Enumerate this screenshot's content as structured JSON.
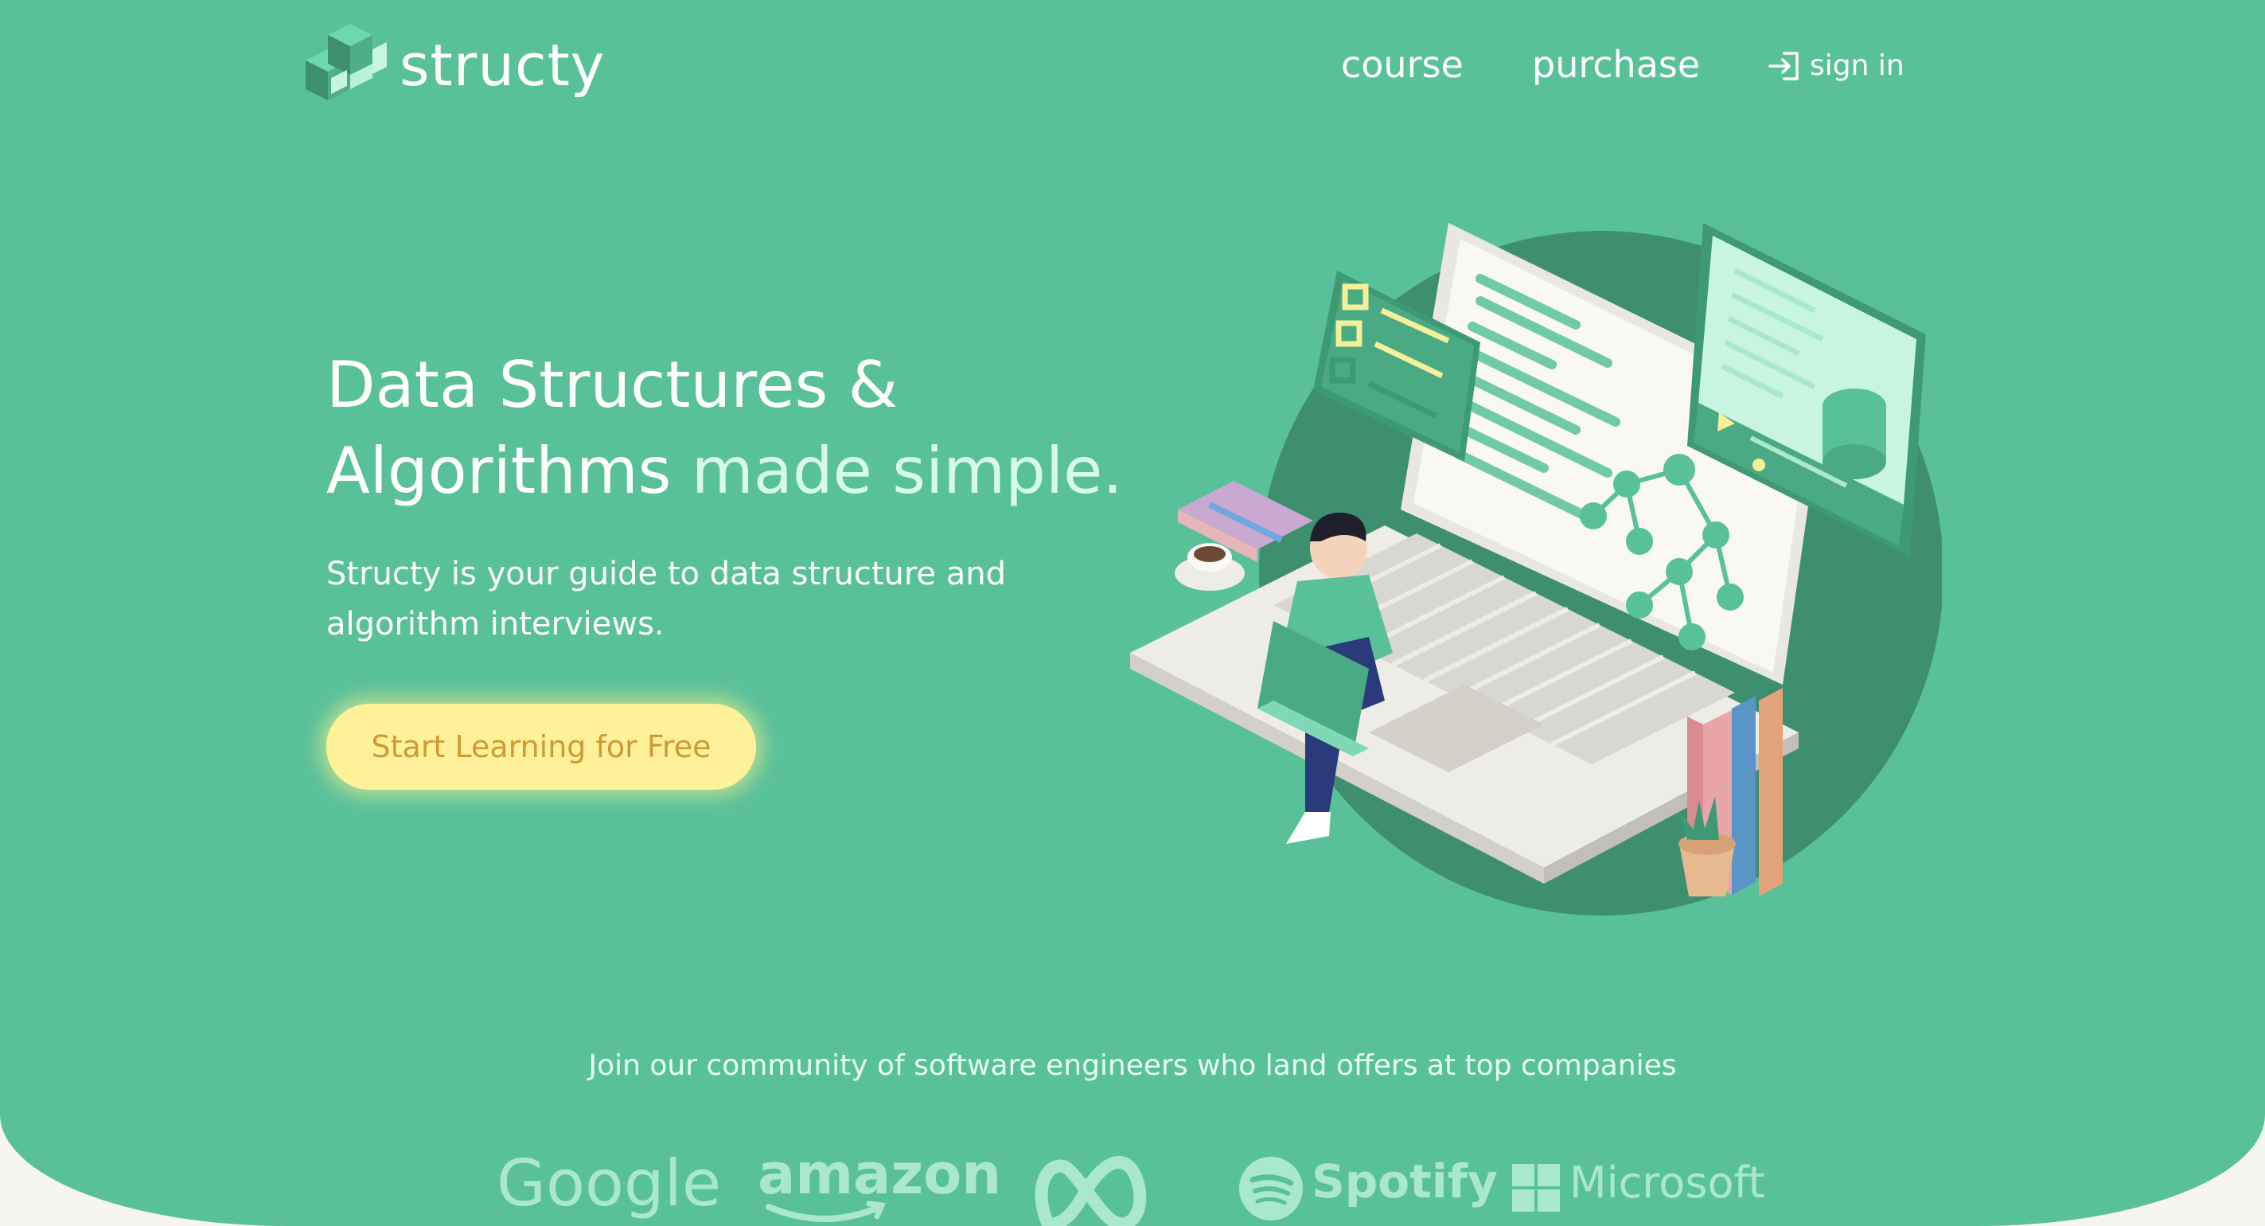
{
  "header": {
    "logo_text": "structy",
    "nav": [
      {
        "label": "course"
      },
      {
        "label": "purchase"
      }
    ],
    "signin_label": "sign in"
  },
  "hero": {
    "headline_line1": "Data Structures &",
    "headline_line2_plain": "Algorithms",
    "headline_line2_accent": "made simple.",
    "subtitle": "Structy is your guide to data structure and algorithm interviews.",
    "cta_label": "Start Learning for Free"
  },
  "community": {
    "text": "Join our community of software engineers who land offers at top companies",
    "brands": [
      "Google",
      "amazon",
      "Spotify",
      "Microsoft"
    ]
  },
  "colors": {
    "background": "#59c19a",
    "accent_text": "#d6fbea",
    "cta_bg": "#fff19a",
    "cta_text": "#cf9a35"
  }
}
